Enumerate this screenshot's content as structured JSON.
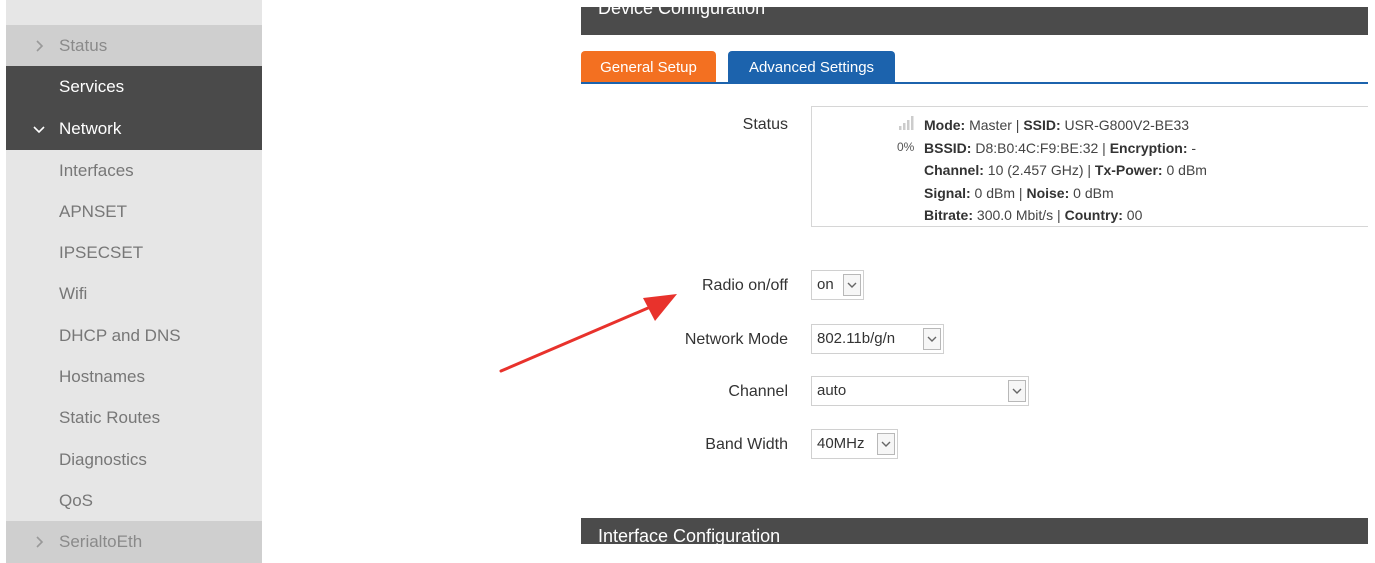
{
  "sidebar": {
    "items": [
      {
        "label": "Status",
        "chevron": "chevron-right-icon"
      },
      {
        "label": "Services"
      },
      {
        "label": "Network",
        "chevron": "chevron-down-icon"
      },
      {
        "label": "Interfaces"
      },
      {
        "label": "APNSET"
      },
      {
        "label": "IPSECSET"
      },
      {
        "label": "Wifi"
      },
      {
        "label": "DHCP and DNS"
      },
      {
        "label": "Hostnames"
      },
      {
        "label": "Static Routes"
      },
      {
        "label": "Diagnostics"
      },
      {
        "label": "QoS"
      },
      {
        "label": "SerialtoEth",
        "chevron": "chevron-right-icon"
      }
    ]
  },
  "main": {
    "device_config_title": "Device Configuration",
    "interface_config_title": "Interface Configuration",
    "tabs": [
      {
        "label": "General Setup",
        "color": "#f37021"
      },
      {
        "label": "Advanced Settings",
        "color": "#1c63ad"
      }
    ],
    "status": {
      "label": "Status",
      "signal_percent": "0%",
      "signal_icon": "wifi-signal-icon",
      "line1": {
        "mode_key": "Mode:",
        "mode_val": " Master | ",
        "ssid_key": "SSID:",
        "ssid_val": " USR-G800V2-BE33"
      },
      "line2": {
        "bssid_key": "BSSID:",
        "bssid_val": " D8:B0:4C:F9:BE:32 | ",
        "enc_key": "Encryption:",
        "enc_val": " -"
      },
      "line3": {
        "channel_key": "Channel:",
        "channel_val": " 10 (2.457 GHz) | ",
        "tx_key": "Tx-Power:",
        "tx_val": " 0 dBm"
      },
      "line4": {
        "signal_key": "Signal:",
        "signal_val": " 0 dBm | ",
        "noise_key": "Noise:",
        "noise_val": " 0 dBm"
      },
      "line5": {
        "bitrate_key": "Bitrate:",
        "bitrate_val": " 300.0 Mbit/s | ",
        "country_key": "Country:",
        "country_val": " 00"
      }
    },
    "fields": {
      "radio": {
        "label": "Radio on/off",
        "value": "on"
      },
      "network_mode": {
        "label": "Network Mode",
        "value": "802.11b/g/n"
      },
      "channel": {
        "label": "Channel",
        "value": "auto"
      },
      "band_width": {
        "label": "Band Width",
        "value": "40MHz"
      }
    },
    "annotation_arrow_color": "#e8322c"
  }
}
